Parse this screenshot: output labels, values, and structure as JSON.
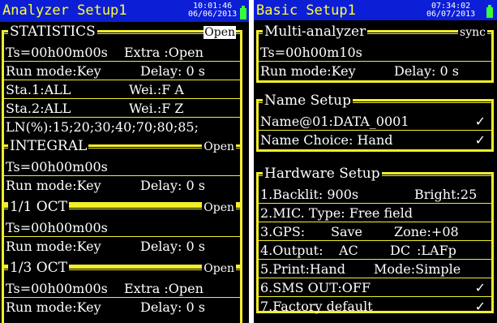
{
  "left": {
    "title": "Analyzer Setup1",
    "time": "10:01:46",
    "date": "06/06/2013",
    "statistics": {
      "title": "STATISTICS",
      "status": "Open",
      "ts": "Ts=00h00m00s",
      "extra": "Extra :Open",
      "run_mode": "Run mode:Key",
      "delay": "Delay: 0 s",
      "sta1": "Sta.1:ALL",
      "wei1": "Wei.:F A",
      "sta2": "Sta.2:ALL",
      "wei2": "Wei.:F Z",
      "ln": "LN(%):15;20;30;40;70;80;85;"
    },
    "integral": {
      "title": "INTEGRAL",
      "status": "Open",
      "ts": "Ts=00h00m00s",
      "run_mode": "Run mode:Key",
      "delay": "Delay: 0 s"
    },
    "oct1": {
      "title": "1/1 OCT",
      "status": "Open",
      "ts": "Ts=00h00m00s",
      "run_mode": "Run mode:Key",
      "delay": "Delay: 0 s"
    },
    "oct3": {
      "title": "1/3 OCT",
      "status": "Open",
      "ts": "Ts=00h00m00s",
      "extra": "Extra :Open",
      "run_mode": "Run mode:Key",
      "delay": "Delay: 0 s"
    }
  },
  "right": {
    "title": "Basic Setup1",
    "time": "07:34:02",
    "date": "06/07/2013",
    "multi": {
      "title": "Multi-analyzer",
      "status": "sync",
      "ts": "Ts=00h00m10s",
      "run_mode": "Run mode:Key",
      "delay": "Delay: 0 s"
    },
    "name": {
      "title": "Name Setup",
      "name01": "Name@01:DATA_0001",
      "choice": "Name Choice: Hand",
      "check": "✓"
    },
    "hardware": {
      "title": "Hardware Setup",
      "backlit": "1.Backlit: 900s",
      "bright": "Bright:25",
      "mic": "2.MIC. Type: Free field",
      "gps": "3.GPS:",
      "gps_save": "Save",
      "zone": "Zone:+08",
      "output": "4.Output:",
      "output_ac": "AC",
      "output_dc": "DC",
      "output_lafp": ":LAFp",
      "print": "5.Print:Hand",
      "mode": "Mode:Simple",
      "sms": "6.SMS OUT:OFF",
      "factory": "7.Factory default",
      "check": "✓"
    }
  },
  "colors": {
    "titlebar": "#0c1fd6",
    "title_text": "#ffff33",
    "frame": "#f2ee2a",
    "battery": "#39ff39",
    "background": "#000000"
  }
}
